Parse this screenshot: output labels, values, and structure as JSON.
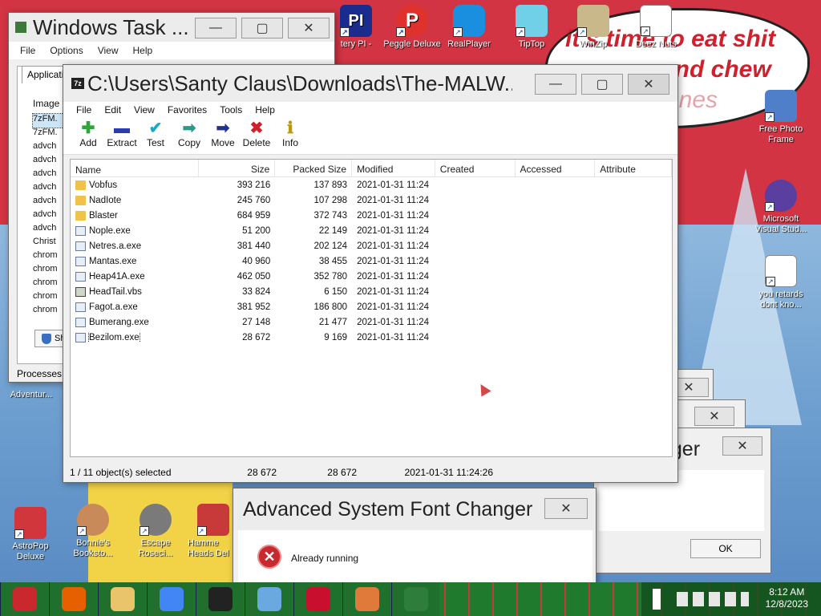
{
  "wallpaper": {
    "speech_line1": "it's time to eat shit",
    "speech_line2": "and chew",
    "speech_line3": "anes"
  },
  "desktop_icons": {
    "top": [
      {
        "label": "tery PI -",
        "icon": "pi-icon"
      },
      {
        "label": "Peggle Deluxe",
        "icon": "peggle-icon"
      },
      {
        "label": "RealPlayer",
        "icon": "realplayer-icon"
      },
      {
        "label": "TipTop",
        "icon": "tiptop-icon"
      },
      {
        "label": "WinZip",
        "icon": "winzip-icon"
      },
      {
        "label": "Deez Nuts",
        "icon": "document-icon"
      }
    ],
    "right": [
      {
        "label": "Free Photo Frame",
        "icon": "photo-frame-icon"
      },
      {
        "label": "Microsoft Visual Stud...",
        "icon": "visual-studio-icon"
      },
      {
        "label": "you retards dont kno...",
        "icon": "document-icon"
      }
    ],
    "bottom": [
      {
        "label": "AstroPop Deluxe",
        "icon": "astropop-icon"
      },
      {
        "label": "Bonnie's Booksto...",
        "icon": "bonnie-icon"
      },
      {
        "label": "Escape Roseci...",
        "icon": "escape-icon"
      },
      {
        "label": "Hamme Heads Del",
        "icon": "hammer-icon"
      }
    ],
    "left_partial": "Adventur..."
  },
  "task_manager": {
    "title": "Windows Task ...",
    "menu": [
      "File",
      "Options",
      "View",
      "Help"
    ],
    "tab": "Applicatio",
    "header": "Image",
    "items": [
      "7zFM.",
      "7zFM.",
      "advch",
      "advch",
      "advch",
      "advch",
      "advch",
      "advch",
      "advch",
      "Christ",
      "chrom",
      "chrom",
      "chrom",
      "chrom",
      "chrom"
    ],
    "show_button": "Sh",
    "processes_label": "Processes:"
  },
  "sevenzip": {
    "app_icon": "7z",
    "title": "C:\\Users\\Santy Claus\\Downloads\\The-MALW...",
    "menu": [
      "File",
      "Edit",
      "View",
      "Favorites",
      "Tools",
      "Help"
    ],
    "toolbar": [
      {
        "label": "Add",
        "glyph": "✚",
        "color": "#2ea43a"
      },
      {
        "label": "Extract",
        "glyph": "▬",
        "color": "#2a3bb8"
      },
      {
        "label": "Test",
        "glyph": "✔",
        "color": "#1fa7c7"
      },
      {
        "label": "Copy",
        "glyph": "➡",
        "color": "#2a9a8a"
      },
      {
        "label": "Move",
        "glyph": "➡",
        "color": "#23308f"
      },
      {
        "label": "Delete",
        "glyph": "✖",
        "color": "#d0202a"
      },
      {
        "label": "Info",
        "glyph": "ℹ",
        "color": "#b89a10"
      }
    ],
    "columns": [
      "Name",
      "Size",
      "Packed Size",
      "Modified",
      "Created",
      "Accessed",
      "Attribute"
    ],
    "files": [
      {
        "name": "Vobfus",
        "type": "folder",
        "size": "393 216",
        "packed": "137 893",
        "modified": "2021-01-31 11:24"
      },
      {
        "name": "NadIote",
        "type": "folder",
        "size": "245 760",
        "packed": "107 298",
        "modified": "2021-01-31 11:24"
      },
      {
        "name": "Blaster",
        "type": "folder",
        "size": "684 959",
        "packed": "372 743",
        "modified": "2021-01-31 11:24"
      },
      {
        "name": "Nople.exe",
        "type": "exe",
        "size": "51 200",
        "packed": "22 149",
        "modified": "2021-01-31 11:24"
      },
      {
        "name": "Netres.a.exe",
        "type": "exe",
        "size": "381 440",
        "packed": "202 124",
        "modified": "2021-01-31 11:24"
      },
      {
        "name": "Mantas.exe",
        "type": "exe",
        "size": "40 960",
        "packed": "38 455",
        "modified": "2021-01-31 11:24"
      },
      {
        "name": "Heap41A.exe",
        "type": "exe",
        "size": "462 050",
        "packed": "352 780",
        "modified": "2021-01-31 11:24"
      },
      {
        "name": "HeadTail.vbs",
        "type": "vbs",
        "size": "33 824",
        "packed": "6 150",
        "modified": "2021-01-31 11:24"
      },
      {
        "name": "Fagot.a.exe",
        "type": "exe",
        "size": "381 952",
        "packed": "186 800",
        "modified": "2021-01-31 11:24"
      },
      {
        "name": "Bumerang.exe",
        "type": "exe",
        "size": "27 148",
        "packed": "21 477",
        "modified": "2021-01-31 11:24"
      },
      {
        "name": "Bezilom.exe",
        "type": "exe",
        "size": "28 672",
        "packed": "9 169",
        "modified": "2021-01-31 11:24",
        "selected": true
      }
    ],
    "progress_fraction": 0.4,
    "status": {
      "selection": "1 / 11 object(s) selected",
      "size": "28 672",
      "packed": "28 672",
      "modified": "2021-01-31 11:24:26"
    }
  },
  "bg_dialog": {
    "title_partial": "nger",
    "ok_label": "OK"
  },
  "font_changer": {
    "title": "Advanced System Font Changer",
    "message": "Already running"
  },
  "taskbar": {
    "apps": [
      {
        "icon": "santa-start-icon",
        "color": "#c8282e"
      },
      {
        "icon": "firefox-icon",
        "color": "#e66000"
      },
      {
        "icon": "file-explorer-icon",
        "color": "#e9c46a"
      },
      {
        "icon": "chrome-icon",
        "color": "#4285f4"
      },
      {
        "icon": "sevenzip-icon",
        "color": "#222222"
      },
      {
        "icon": "paint-icon",
        "color": "#6aa8e0"
      },
      {
        "icon": "acrobat-icon",
        "color": "#c8102e"
      },
      {
        "icon": "fish-icon",
        "color": "#e07a3a"
      },
      {
        "icon": "task-manager-icon",
        "color": "#2f7d3a"
      }
    ],
    "clock_time": "8:12 AM",
    "clock_date": "12/8/2023"
  }
}
